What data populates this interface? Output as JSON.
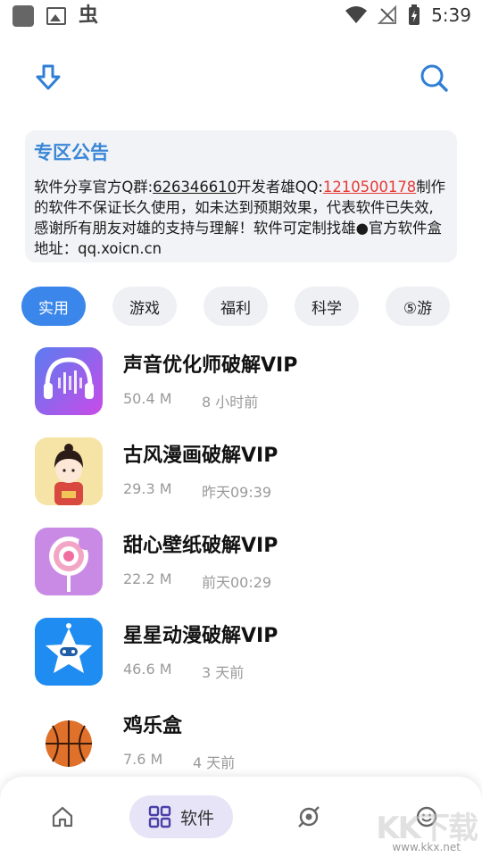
{
  "status_bar": {
    "notif_char": "虫",
    "time": "5:39"
  },
  "notice": {
    "title": "专区公告",
    "text_1": "软件分享官方Q群:",
    "qq_group": "626346610",
    "text_2": "开发者雄QQ:",
    "dev_qq": "1210500178",
    "text_3": "制作的软件不保证长久使用，如未达到预期效果，代表软件已失效,感谢所有朋友对雄的支持与理解！软件可定制找雄●官方软件盒地址：qq.xoicn.cn"
  },
  "tabs": [
    {
      "label": "实用",
      "active": true
    },
    {
      "label": "游戏",
      "active": false
    },
    {
      "label": "福利",
      "active": false
    },
    {
      "label": "科学",
      "active": false
    },
    {
      "label": "⑤游",
      "active": false
    }
  ],
  "apps": [
    {
      "name": "声音优化师破解VIP",
      "size": "50.4 M",
      "time": "8 小时前",
      "icon": "headphone-girl-icon"
    },
    {
      "name": "古风漫画破解VIP",
      "size": "29.3 M",
      "time": "昨天09:39",
      "icon": "ancient-girl-icon"
    },
    {
      "name": "甜心壁纸破解VIP",
      "size": "22.2 M",
      "time": "前天00:29",
      "icon": "lollipop-icon"
    },
    {
      "name": "星星动漫破解VIP",
      "size": "46.6 M",
      "time": "3 天前",
      "icon": "star-robot-icon"
    },
    {
      "name": "鸡乐盒",
      "size": "7.6 M",
      "time": "4 天前",
      "icon": "basketball-icon"
    }
  ],
  "bottom_nav": {
    "software_label": "软件"
  },
  "watermark": {
    "text": "KK下载",
    "url": "www.kkx.net"
  },
  "colors": {
    "accent": "#3a86ea",
    "notice_title": "#3a86d8",
    "link_red": "#e53935",
    "nav_active_bg": "#e6e4f6"
  }
}
